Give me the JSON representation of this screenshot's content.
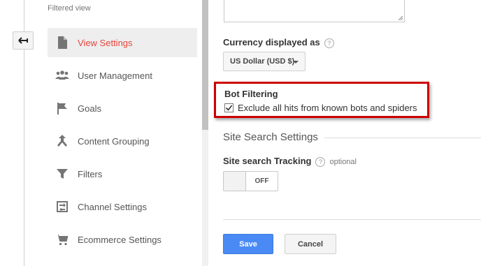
{
  "sidebar": {
    "section_label": "Filtered view",
    "items": [
      {
        "label": "View Settings",
        "icon": "document-icon",
        "active": true
      },
      {
        "label": "User Management",
        "icon": "users-icon",
        "active": false
      },
      {
        "label": "Goals",
        "icon": "flag-icon",
        "active": false
      },
      {
        "label": "Content Grouping",
        "icon": "grouping-icon",
        "active": false
      },
      {
        "label": "Filters",
        "icon": "funnel-icon",
        "active": false
      },
      {
        "label": "Channel Settings",
        "icon": "channel-icon",
        "active": false
      },
      {
        "label": "Ecommerce Settings",
        "icon": "cart-icon",
        "active": false
      }
    ]
  },
  "main": {
    "currency": {
      "label": "Currency displayed as",
      "help": "?",
      "selected": "US Dollar (USD $)"
    },
    "bot_filtering": {
      "title": "Bot Filtering",
      "checkbox_label": "Exclude all hits from known bots and spiders",
      "checked": true
    },
    "site_search": {
      "section_title": "Site Search Settings",
      "tracking_label": "Site search Tracking",
      "help": "?",
      "optional": "optional",
      "toggle_state": "OFF"
    },
    "actions": {
      "save_label": "Save",
      "cancel_label": "Cancel"
    }
  },
  "colors": {
    "active_nav": "#e8453c",
    "highlight_border": "#cc0000",
    "primary_button": "#4a8af4"
  }
}
